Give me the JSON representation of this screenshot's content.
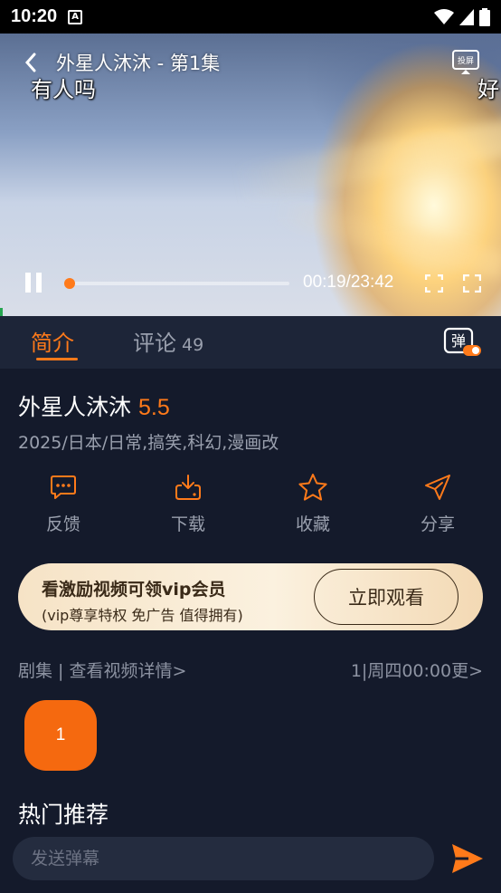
{
  "status_bar": {
    "time": "10:20",
    "app_icon_letter": "A"
  },
  "player": {
    "title": "外星人沐沐 - 第1集",
    "danmaku": [
      "有人吗",
      "好"
    ],
    "cast_label": "投屏",
    "timecode": "00:19/23:42",
    "progress": 0.013,
    "accent": "#ff7a1a"
  },
  "tabs": {
    "intro": "简介",
    "comments": "评论",
    "comments_count": "49",
    "danmu_label": "弹"
  },
  "show": {
    "title": "外星人沐沐",
    "score": "5.5",
    "meta": "2025/日本/日常,搞笑,科幻,漫画改"
  },
  "actions": [
    {
      "label": "反馈",
      "icon": "feedback-icon"
    },
    {
      "label": "下载",
      "icon": "download-icon"
    },
    {
      "label": "收藏",
      "icon": "star-icon"
    },
    {
      "label": "分享",
      "icon": "share-icon"
    }
  ],
  "vip": {
    "title": "看激励视频可领vip会员",
    "subtitle": "(vip尊享特权 免广告 值得拥有)",
    "button": "立即观看"
  },
  "episodes": {
    "left": "剧集 | 查看视频详情>",
    "right": "1|周四00:00更>",
    "items": [
      "1"
    ]
  },
  "hot": {
    "title": "热门推荐"
  },
  "input": {
    "placeholder": "发送弹幕"
  }
}
